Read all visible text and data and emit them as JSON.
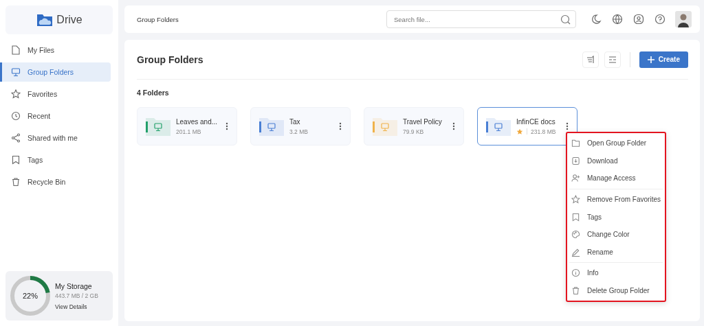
{
  "logo": {
    "text": "Drive"
  },
  "sidebar": {
    "items": [
      {
        "label": "My Files",
        "selected": false
      },
      {
        "label": "Group Folders",
        "selected": true
      },
      {
        "label": "Favorites",
        "selected": false
      },
      {
        "label": "Recent",
        "selected": false
      },
      {
        "label": "Shared with me",
        "selected": false
      },
      {
        "label": "Tags",
        "selected": false
      },
      {
        "label": "Recycle Bin",
        "selected": false
      }
    ]
  },
  "storage": {
    "title": "My Storage",
    "percent": "22%",
    "level": 0.22,
    "usage": "443.7 MB / 2 GB",
    "link": "View Details"
  },
  "topbar": {
    "breadcrumb": "Group Folders",
    "search": {
      "placeholder": "Search file..."
    }
  },
  "page": {
    "title": "Group Folders",
    "create_button": "Create",
    "count": "4 Folders"
  },
  "folders": [
    {
      "name": "Leaves and...",
      "size": "201.1 MB",
      "color": "#22a06b",
      "favorite": false,
      "selected": false
    },
    {
      "name": "Tax",
      "size": "3.2 MB",
      "color": "#4a7fd4",
      "favorite": false,
      "selected": false
    },
    {
      "name": "Travel Policy",
      "size": "79.9 KB",
      "color": "#f0b24a",
      "favorite": false,
      "selected": false
    },
    {
      "name": "InfinCE docs",
      "size": "231.8 MB",
      "color": "#4a7fd4",
      "favorite": true,
      "selected": true
    }
  ],
  "context_menu": {
    "highlighted": true,
    "groups": [
      [
        "Open Group Folder",
        "Download",
        "Manage Access"
      ],
      [
        "Remove From Favorites",
        "Tags",
        "Change Color",
        "Rename"
      ],
      [
        "Info",
        "Delete Group Folder"
      ]
    ]
  }
}
